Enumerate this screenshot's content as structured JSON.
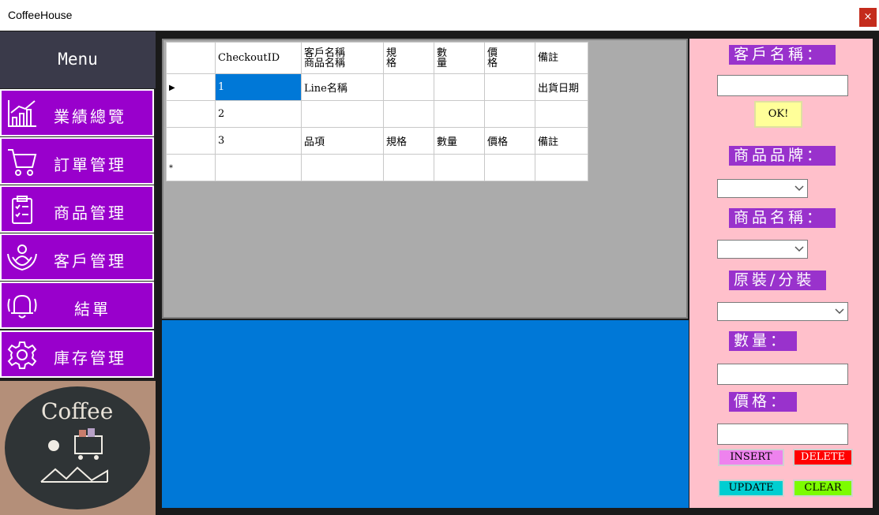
{
  "window": {
    "title": "CoffeeHouse",
    "close_glyph": "×"
  },
  "sidebar": {
    "header": "Menu",
    "items": [
      {
        "label": "業績總覽",
        "icon": "chart-icon"
      },
      {
        "label": "訂單管理",
        "icon": "cart-icon"
      },
      {
        "label": "商品管理",
        "icon": "clipboard-icon"
      },
      {
        "label": "客戶管理",
        "icon": "customer-care-icon"
      },
      {
        "label": "結單",
        "icon": "bell-icon"
      },
      {
        "label": "庫存管理",
        "icon": "gear-icon"
      }
    ],
    "logo_text": "Coffee"
  },
  "grid": {
    "columns": [
      "CheckoutID",
      "客戶名稱\n商品名稱",
      "規\n格",
      "數\n量",
      "價\n格",
      "備註"
    ],
    "rows": [
      [
        "1",
        "Line名稱",
        "",
        "",
        "",
        "出貨日期"
      ],
      [
        "2",
        "",
        "",
        "",
        "",
        ""
      ],
      [
        "3",
        "品項",
        "規格",
        "數量",
        "價格",
        "備註"
      ]
    ],
    "current_row_marker": "▶",
    "new_row_marker": "*"
  },
  "form": {
    "customer_label": "客戶名稱：",
    "customer_value": "",
    "ok_button": "OK!",
    "brand_label": "商品品牌：",
    "brand_value": "",
    "product_label": "商品名稱：",
    "product_value": "",
    "pack_label": "原裝/分裝",
    "pack_value": "",
    "qty_label": "數量：",
    "qty_value": "",
    "price_label": "價格：",
    "price_value": ""
  },
  "buttons": {
    "insert": "INSERT",
    "delete": "DELETE",
    "update": "UPDATE",
    "clear": "CLEAR"
  },
  "colors": {
    "nav_purple": "#9900cc",
    "label_purple": "#9932cc",
    "panel_pink": "#ffc0cb",
    "selection_blue": "#0078d7",
    "insert": "#ee82ee",
    "delete": "#ff0000",
    "update": "#00ced1",
    "clear": "#7cfc00",
    "ok": "#ffff99"
  }
}
